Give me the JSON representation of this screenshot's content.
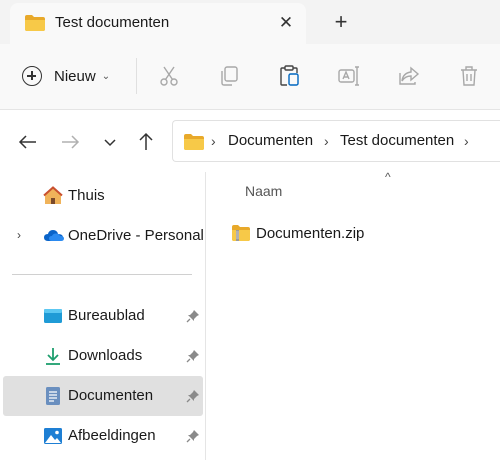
{
  "tab": {
    "title": "Test documenten",
    "close_glyph": "✕",
    "new_tab_glyph": "+"
  },
  "toolbar": {
    "new_label": "Nieuw",
    "new_caret": "⌄",
    "icons": [
      "cut-icon",
      "copy-icon",
      "paste-icon",
      "rename-icon",
      "share-icon",
      "delete-icon"
    ]
  },
  "address": {
    "breadcrumbs": [
      "Documenten",
      "Test documenten"
    ],
    "separator": "›"
  },
  "sidebar": {
    "items": [
      {
        "label": "Thuis",
        "icon": "home-icon"
      },
      {
        "label": "OneDrive - Personal",
        "icon": "onedrive-icon",
        "expander": "›"
      },
      {
        "label": "Bureaublad",
        "icon": "desktop-icon",
        "pinned": true
      },
      {
        "label": "Downloads",
        "icon": "downloads-icon",
        "pinned": true
      },
      {
        "label": "Documenten",
        "icon": "documents-icon",
        "pinned": true,
        "selected": true
      },
      {
        "label": "Afbeeldingen",
        "icon": "pictures-icon",
        "pinned": true
      }
    ]
  },
  "main": {
    "sort_arrow": "^",
    "column_header": "Naam",
    "files": [
      {
        "name": "Documenten.zip",
        "icon": "zip-folder-icon"
      }
    ]
  },
  "colors": {
    "accent": "#0067c0",
    "folder": "#f5c443",
    "selected": "#e0e0e0"
  }
}
